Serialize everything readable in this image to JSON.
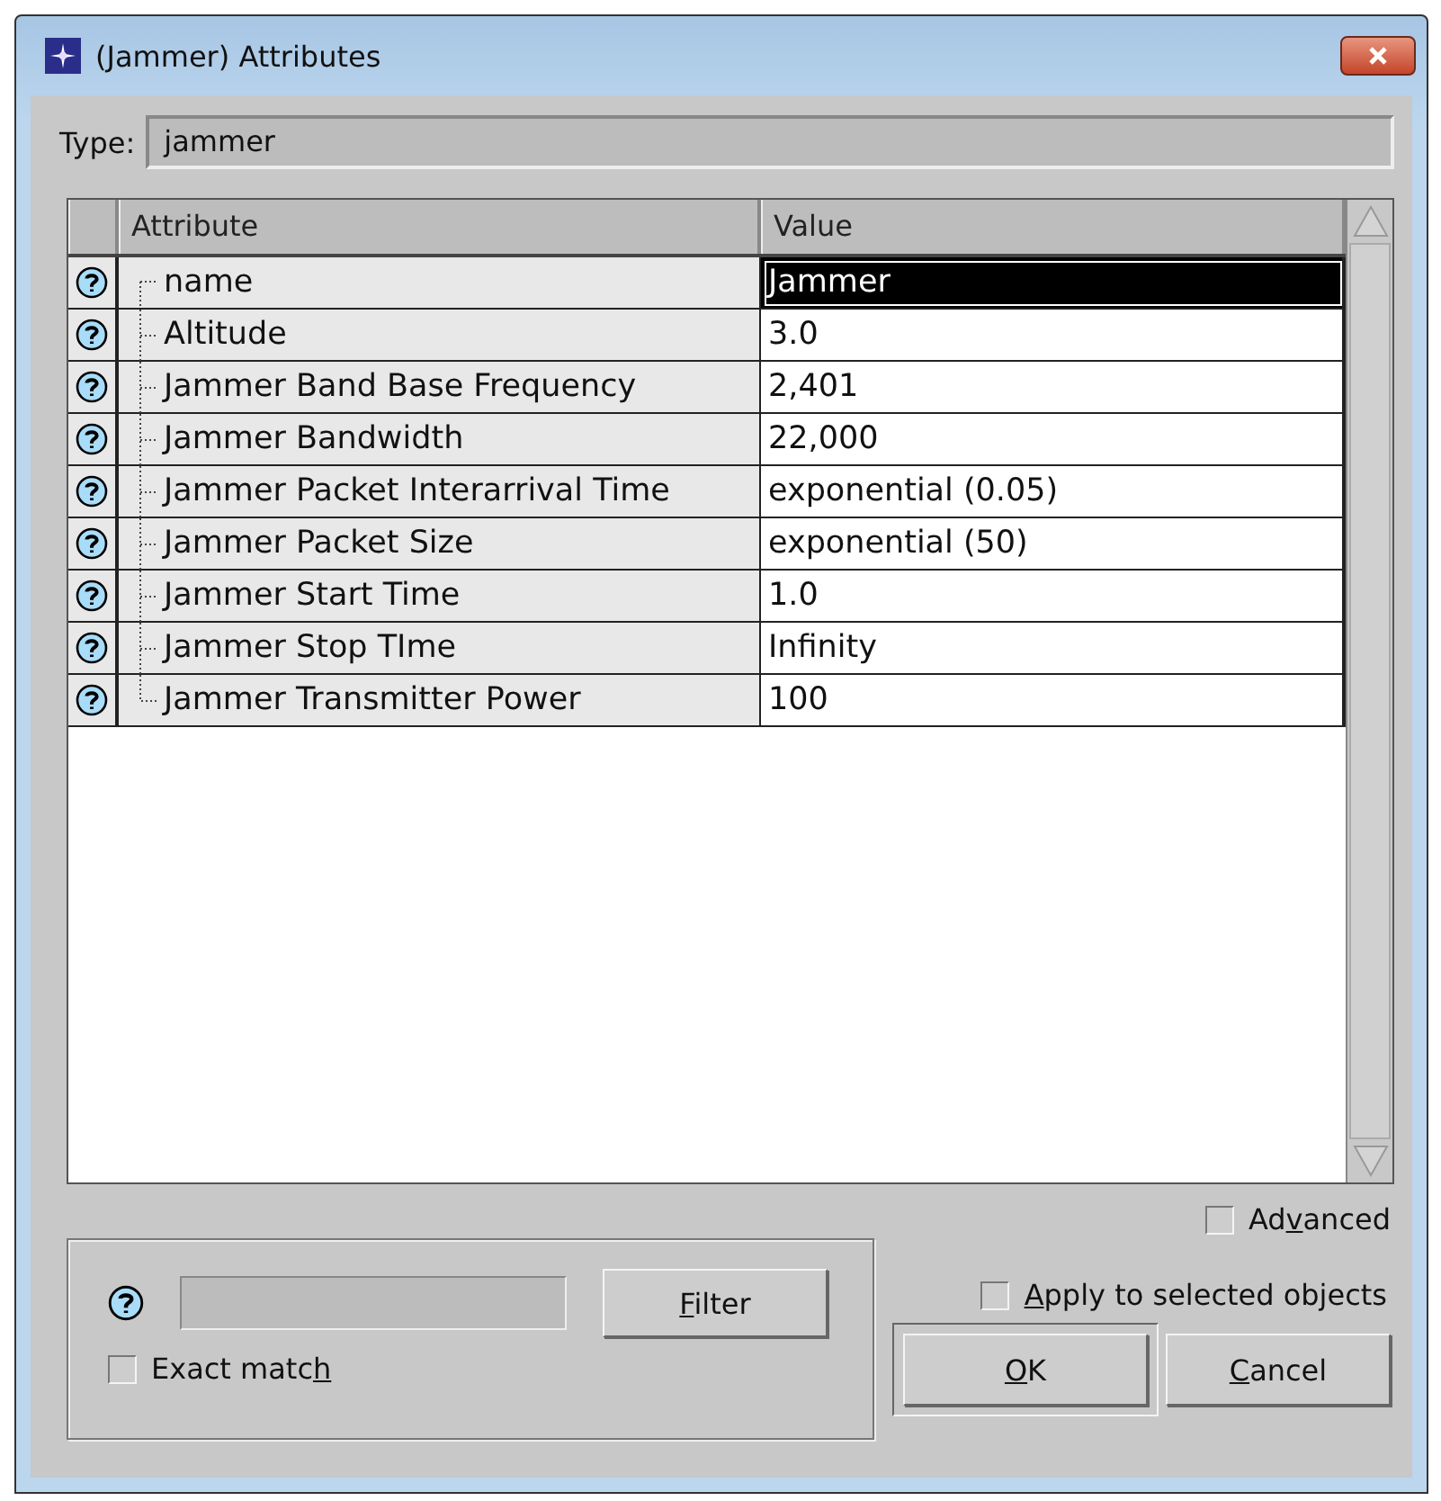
{
  "window": {
    "title": "(Jammer) Attributes"
  },
  "type_field": {
    "label": "Type:",
    "value": "jammer"
  },
  "table": {
    "columns": [
      "Attribute",
      "Value"
    ],
    "rows": [
      {
        "attribute": "name",
        "value": "Jammer",
        "selected": true
      },
      {
        "attribute": "Altitude",
        "value": "3.0",
        "selected": false
      },
      {
        "attribute": "Jammer Band Base Frequency",
        "value": "2,401",
        "selected": false
      },
      {
        "attribute": "Jammer Bandwidth",
        "value": "22,000",
        "selected": false
      },
      {
        "attribute": "Jammer Packet Interarrival Time",
        "value": "exponential (0.05)",
        "selected": false
      },
      {
        "attribute": "Jammer Packet Size",
        "value": "exponential (50)",
        "selected": false
      },
      {
        "attribute": "Jammer Start Time",
        "value": "1.0",
        "selected": false
      },
      {
        "attribute": "Jammer Stop TIme",
        "value": "Infinity",
        "selected": false
      },
      {
        "attribute": "Jammer Transmitter Power",
        "value": "100",
        "selected": false
      }
    ]
  },
  "filter": {
    "button": {
      "key": "F",
      "after": "ilter"
    },
    "exact_match": {
      "label": {
        "before": "Exact matc",
        "key": "h"
      },
      "checked": false
    }
  },
  "advanced": {
    "label": {
      "before": "Ad",
      "key": "v",
      "after": "anced"
    },
    "checked": false
  },
  "apply_to_selected": {
    "label": {
      "key": "A",
      "after": "pply to selected objects"
    },
    "checked": false
  },
  "buttons": [
    {
      "key": "O",
      "after": "K"
    },
    {
      "key": "C",
      "after": "ancel"
    }
  ]
}
